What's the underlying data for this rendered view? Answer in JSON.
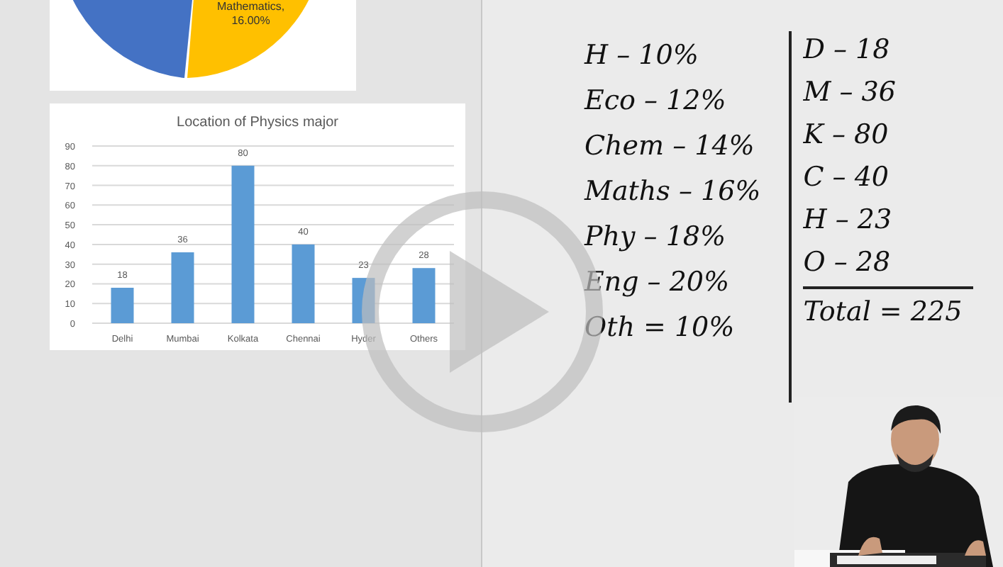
{
  "pie_label": "Mathematics,\n16.00%",
  "chart": {
    "chart_data": {
      "type": "bar",
      "title": "Location of Physics major",
      "categories": [
        "Delhi",
        "Mumbai",
        "Kolkata",
        "Chennai",
        "Hyder",
        "Others"
      ],
      "series": [
        {
          "color": "#5b9bd5",
          "values": [
            18,
            36,
            80,
            40,
            23,
            28
          ]
        }
      ],
      "grid": true,
      "ylim": [
        0,
        90
      ],
      "yticks": [
        0,
        10,
        20,
        30,
        40,
        50,
        60,
        70,
        80,
        90
      ],
      "data_labels": true
    }
  },
  "notes_left": [
    "H – 10%",
    "Eco – 12%",
    "Chem – 14%",
    "Maths – 16%",
    "Phy – 18%",
    "Eng – 20%",
    "Oth = 10%"
  ],
  "notes_right": [
    "D – 18",
    "M – 36",
    "K – 80",
    "C – 40",
    "H – 23",
    "O – 28"
  ],
  "notes_total": "Total = 225",
  "presenter": {
    "kind": "picture"
  }
}
